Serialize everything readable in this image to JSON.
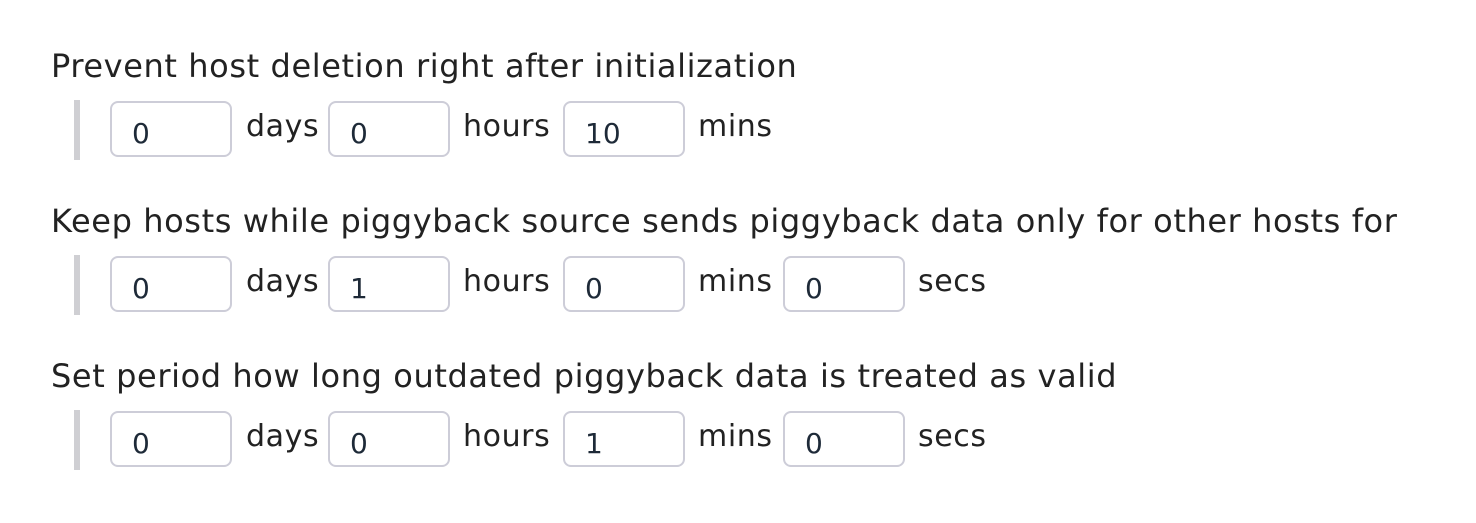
{
  "sections": [
    {
      "title": "Prevent host deletion right after initialization",
      "fields": [
        {
          "value": "0",
          "unit": "days"
        },
        {
          "value": "0",
          "unit": "hours"
        },
        {
          "value": "10",
          "unit": "mins"
        }
      ]
    },
    {
      "title": "Keep hosts while piggyback source sends piggyback data only for other hosts for",
      "fields": [
        {
          "value": "0",
          "unit": "days"
        },
        {
          "value": "1",
          "unit": "hours"
        },
        {
          "value": "0",
          "unit": "mins"
        },
        {
          "value": "0",
          "unit": "secs"
        }
      ]
    },
    {
      "title": "Set period how long outdated piggyback data is treated as valid",
      "fields": [
        {
          "value": "0",
          "unit": "days"
        },
        {
          "value": "0",
          "unit": "hours"
        },
        {
          "value": "1",
          "unit": "mins"
        },
        {
          "value": "0",
          "unit": "secs"
        }
      ]
    }
  ]
}
